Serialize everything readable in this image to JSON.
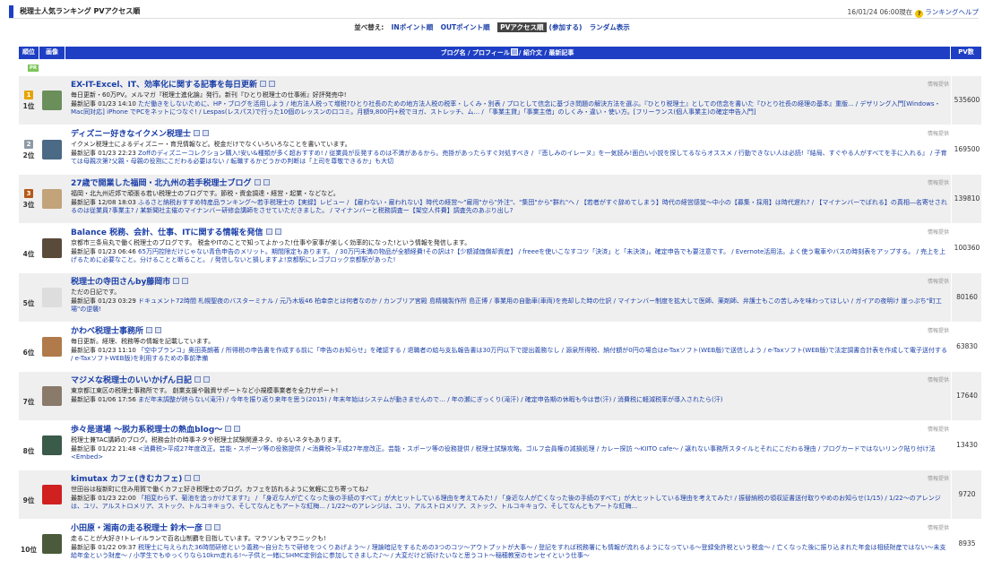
{
  "header": {
    "title": "税理士人気ランキング PVアクセス順",
    "datetime": "16/01/24 06:00現在",
    "help_label": "ランキングヘルプ",
    "help_icon": "?"
  },
  "sortbar": {
    "label": "並べ替え:",
    "options": [
      "INポイント順",
      "OUTポイント順",
      "PVアクセス順",
      "(参加する)",
      "ランダム表示"
    ],
    "selected_index": 2
  },
  "table_header": {
    "rank": "順位",
    "image": "画像",
    "main_pre": "ブログ名 / プロフィール",
    "main_post": "/ 紹介文 / 最新記事",
    "pv": "PV数"
  },
  "pr_badge": "PR",
  "ad_label": "情報提供",
  "recent_prefix": "最新記事",
  "rows": [
    {
      "rank": "1位",
      "crown": "1",
      "title": "EX-IT-Excel、IT、効率化に関する記事を毎日更新",
      "desc": "毎日更新・60万PV。メルマガ『税理士進化論』発行。新刊『ひとり税理士の仕事術』好評発売中!",
      "date": "01/23 14:10",
      "links": "ただ働きをしないために、HP・ブログを活用しよう / 地方法人税って増税?ひとり社長のための地方法人税の税率・しくみ・別表 / プロとして信念に基づき問題の解決方法を選ぶ。『ひとり税理士』としての信念を書いた『ひとり社長の経理の基本』重版... / デザリング入門[Windows・Mac同対応] iPhone でPCをネットにつなぐ! / Lespas(レスパス)で行った10個のレッスンの口コミ。月額9,800円+税でヨガ、ストレッチ、ム... / 「事業主貸」「事業主借」のしくみ・違い・使い方。[フリーランス(個人事業主)の確定申告入門]",
      "pv": "535600"
    },
    {
      "rank": "2位",
      "crown": "2",
      "title": "ディズニー好きなイクメン税理士",
      "desc": "イクメン税理士によるディズニー・育児情報など。税金だけでなくいろいろなことを書いています。",
      "date": "01/23 22:23",
      "links": "Zoffのディズニーコレクション購入!安い&種類が多く超おすすめ! / 従業員が反発するのは不満があるから。売掛があったらすぐ対処すべき / 『悲しみのイレーヌ』を一気読み!面白い小説を探してるならオススメ / 行動できない人は必読!『結局、すぐやる人がすべてを手に入れる』 / 子育ては母親次第?父親・母親の役割にこだわる必要はない / 転職するかどうかの判断は「上司を尊敬できるか」も大切",
      "pv": "169500"
    },
    {
      "rank": "3位",
      "crown": "3",
      "title": "27歳で開業した福岡・北九州の若手税理士ブログ",
      "desc": "福岡・北九州近郊で頑張る若い税理士のブログです。節税・資金調達・経営・起業・などなど。",
      "date": "12/08 18:03",
      "links": "ふるさと納税おすすめ特産品ランキング〜若手税理士の【実録】レビュー / 【雇わない・雇われない】時代の経営〜\"雇用\"から\"外注\"、\"集団\"から\"群れ\"へ / 【若者がすぐ辞めてしまう】時代の経営感覚〜中小の【募集・採用】は時代遅れ? / 【マイナンバーでばれる】の真相―名寄せされるのは従業員?事業主? / 某新聞社主催のマイナンバー研修会講師をさせていただきました。 / マイナンバーと税務調査ー【架空人件費】調査先のあぶり出し?",
      "pv": "139810"
    },
    {
      "rank": "4位",
      "crown": "",
      "title": "Balance 税務、会計、仕事、ITに関する情報を発信",
      "desc": "京都市三条烏丸で働く税理士のブログです。 税金やITのことで知ってよかった!仕事や家事が楽しく効率的になった!という情報を発信します。",
      "date": "01/23 06:46",
      "links": "65万円控除だけじゃない青色申告のメリット。期間限定もあります。 / 30万円未満の物品が全額経費!その訳は?【少額減価償却資産】 / freeeを使いこなすコツ「決済」と「未決済」。確定申告でも要注意です。 / Evernote活用法。よく使う電車やバスの時刻表をアップする。 / 売上を上げるために必要なこと。分けることと断ること。 / 発信しないと損しますよ!京都駅にレゴブロック京都駅があった!",
      "pv": "100360"
    },
    {
      "rank": "5位",
      "crown": "",
      "title": "税理士の寺田さんby藤岡市",
      "desc": "ただの日記です。",
      "date": "01/23 03:29",
      "links": "ドキュメント72時間 札幌聖夜のバスターミナル / 元乃木坂46 柏幸奈とは何者なのか / カンブリア宮殿 島精機製作所 島正博 / 事業用の自動車(車両)を売却した時の仕訳 / マイナンバー制度を拡大して医師、薬剤師、弁護士もこの苦しみを味わってほしい / ガイアの夜明け 崖っぷち\"町工場\"の逆襲!",
      "pv": "80160"
    },
    {
      "rank": "6位",
      "crown": "",
      "title": "かわべ税理士事務所",
      "desc": "毎日更新。経理、税務等の情報を記載しています。",
      "date": "01/23 11:10",
      "links": "「空中ブランコ」奥田英朗著 / 所得税の申告書を作成する前に「申告のお知らせ」を確認する / 退職者の給与支払報告書は30万円以下で提出義務なし / 源泉所得税、納付額が0円の場合はe-Taxソフト(WEB版)で送信しよう / e-Taxソフト(WEB版)で法定調書合計表を作成して電子送付する / e-TaxソフトWEB版)を利用するための事前準備",
      "pv": "63830"
    },
    {
      "rank": "7位",
      "crown": "",
      "title": "マジメな税理士のいいかげん日記",
      "desc": "東京都江東区の税理士事務所です。 創業支援や融資サポートなど小規模事業者を全力サポート!",
      "date": "01/06 17:56",
      "links": "まだ年末調整が終らない(滝汗) / 今年を振り返り来年を思う(2015) / 年末年始はシステムが動きませんので… / 年の瀬にぎっくり(滝汗) / 確定申告期の休暇も今は昔(汗) / 消費税に軽減税率が導入されたら(汗)",
      "pv": "17640"
    },
    {
      "rank": "8位",
      "crown": "",
      "title": "歩々是道場 〜脱力系税理士の熱血blog〜",
      "desc": "税理士兼TAC講師のブログ。税務会計の時事ネタや税理士試験関連ネタ、ゆるいネタもあります。",
      "date": "01/22 21:48",
      "links": "<消費税>平成27年度改正。芸能・スポーツ等の役務提供 / <消費税>平成27年度改正。芸能・スポーツ等の役務提供 / 税理士試験攻略。ゴルフ会員権の減損処理 / カレー探訪 〜KIITO cafe〜 / 譲れない事務所スタイルとそれにこだわる理由 / ブログカードではないリンク貼り付け法 <Embed>",
      "pv": "13430"
    },
    {
      "rank": "9位",
      "crown": "",
      "title": "kimutax カフェ(きむカフェ)",
      "desc": "世田谷は桜新町に住み用賀で働くカフェ好き税理士のブログ。カフェを訪れるように気軽に立ち寄ってね♪",
      "date": "01/23 22:00",
      "links": "「相変わらず、菊池を追っかけてます?」 / 「身近な人が亡くなった後の手続のすべて」が大ヒットしている理由を考えてみた! / 「身近な人が亡くなった後の手続のすべて」が大ヒットしている理由を考えてみた! / 振替納税の領収証書送付取りやめのお知らせ(1/15) / 1/22〜のアレンジは、ユリ、アルストロメリア、ストック、トルコキキョウ、そしてなんともアートな紅梅... / 1/22〜のアレンジは、ユリ、アルストロメリア、ストック、トルコキキョウ、そしてなんともアートな紅梅...",
      "pv": "9720"
    },
    {
      "rank": "10位",
      "crown": "",
      "title": "小田原・湘南の走る税理士 鈴木一彦",
      "desc": "走ることが大好き!トレイルランで百名山制覇を目指しています。マラソンもマラニックも!",
      "date": "01/22 09:37",
      "links": "税理士に与えられた36時間研修という義務〜自分たちで研修をつくりあげよう〜 / 理論暗記をするための3つのコツ〜アウトプットが大事〜 / 登記をすれば税務署にも情報が流れるようになっている〜登録免許税という税金〜 / 亡くなった後に振り込まれた年金は相続財産ではない〜未支給年金という財産〜 / 小学生でもゆっくりなら10km走れる!〜子供と一緒にSHMC定例会に参加してきました♪〜 / 大変だけど続けたいなと思うコト〜稲穂教室のセンセイという仕事〜",
      "pv": "8935"
    }
  ]
}
